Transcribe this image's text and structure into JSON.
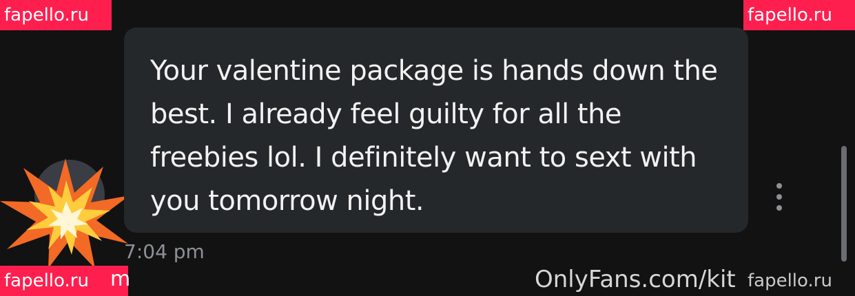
{
  "watermarks": {
    "top_left": "fapello.ru",
    "top_right": "fapello.ru",
    "bottom_left": "fapello.ru",
    "bottom_right": "fapello.ru"
  },
  "message": {
    "text": "Your valentine package is hands down the best. I already feel guilty for all the freebies lol. I definitely want to sext with you tomorrow night.",
    "timestamp": "7:04 pm"
  },
  "footer": {
    "site_url": "OnlyFans.com/kit",
    "cropped_tail": "m"
  },
  "icons": {
    "avatar": "avatar",
    "burst": "collision-emoji-icon",
    "menu": "more-vertical-icon"
  },
  "colors": {
    "background": "#121213",
    "bubble": "#25282a",
    "watermark": "#ff1f4f",
    "text": "#f2f2f2",
    "muted": "#8e9196"
  }
}
